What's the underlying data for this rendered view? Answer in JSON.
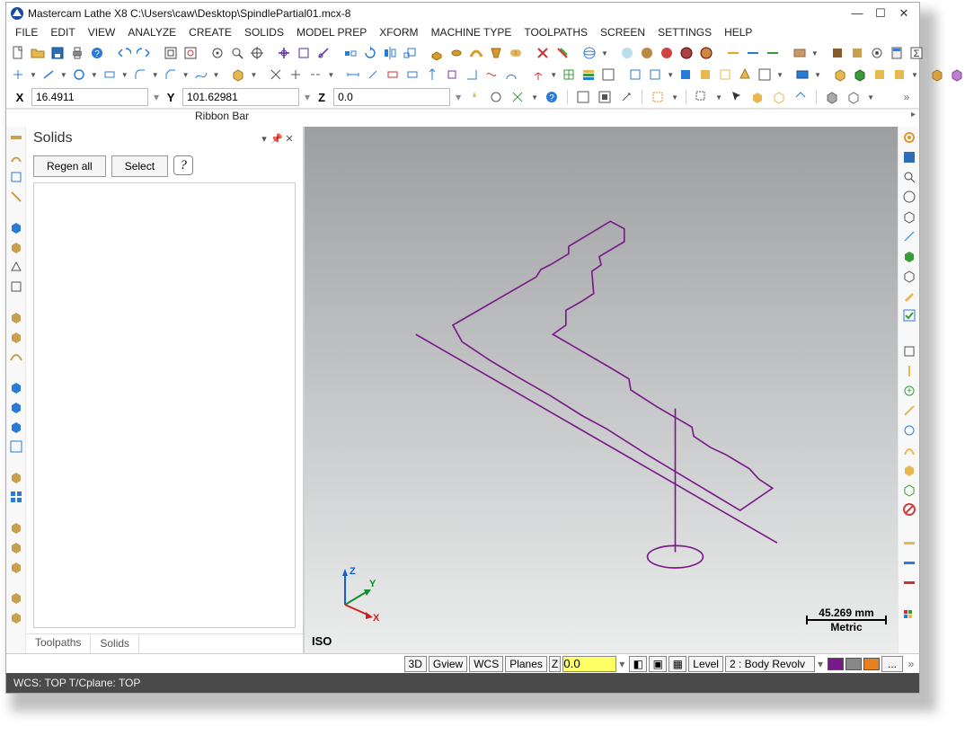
{
  "title": "Mastercam Lathe X8  C:\\Users\\caw\\Desktop\\SpindlePartial01.mcx-8",
  "menu": [
    "FILE",
    "EDIT",
    "VIEW",
    "ANALYZE",
    "CREATE",
    "SOLIDS",
    "MODEL PREP",
    "XFORM",
    "MACHINE TYPE",
    "TOOLPATHS",
    "SCREEN",
    "SETTINGS",
    "HELP"
  ],
  "coords": {
    "x_label": "X",
    "x": "16.4911",
    "y_label": "Y",
    "y": "101.62981",
    "z_label": "Z",
    "z": "0.0"
  },
  "ribbon_label": "Ribbon Bar",
  "panel": {
    "title": "Solids",
    "regen": "Regen all",
    "select": "Select",
    "tabs": {
      "toolpaths": "Toolpaths",
      "solids": "Solids"
    }
  },
  "viewport": {
    "iso": "ISO",
    "scale_value": "45.269 mm",
    "scale_unit": "Metric",
    "triad": {
      "x": "X",
      "y": "Y",
      "z": "Z"
    }
  },
  "bottom": {
    "btn_3d": "3D",
    "btn_gview": "Gview",
    "btn_wcs": "WCS",
    "btn_planes": "Planes",
    "z_label": "Z",
    "z_val": "0.0",
    "level_label": "Level",
    "level_val": "2 : Body Revolv",
    "ellipsis": "..."
  },
  "statusbar": "WCS: TOP  T/Cplane: TOP"
}
